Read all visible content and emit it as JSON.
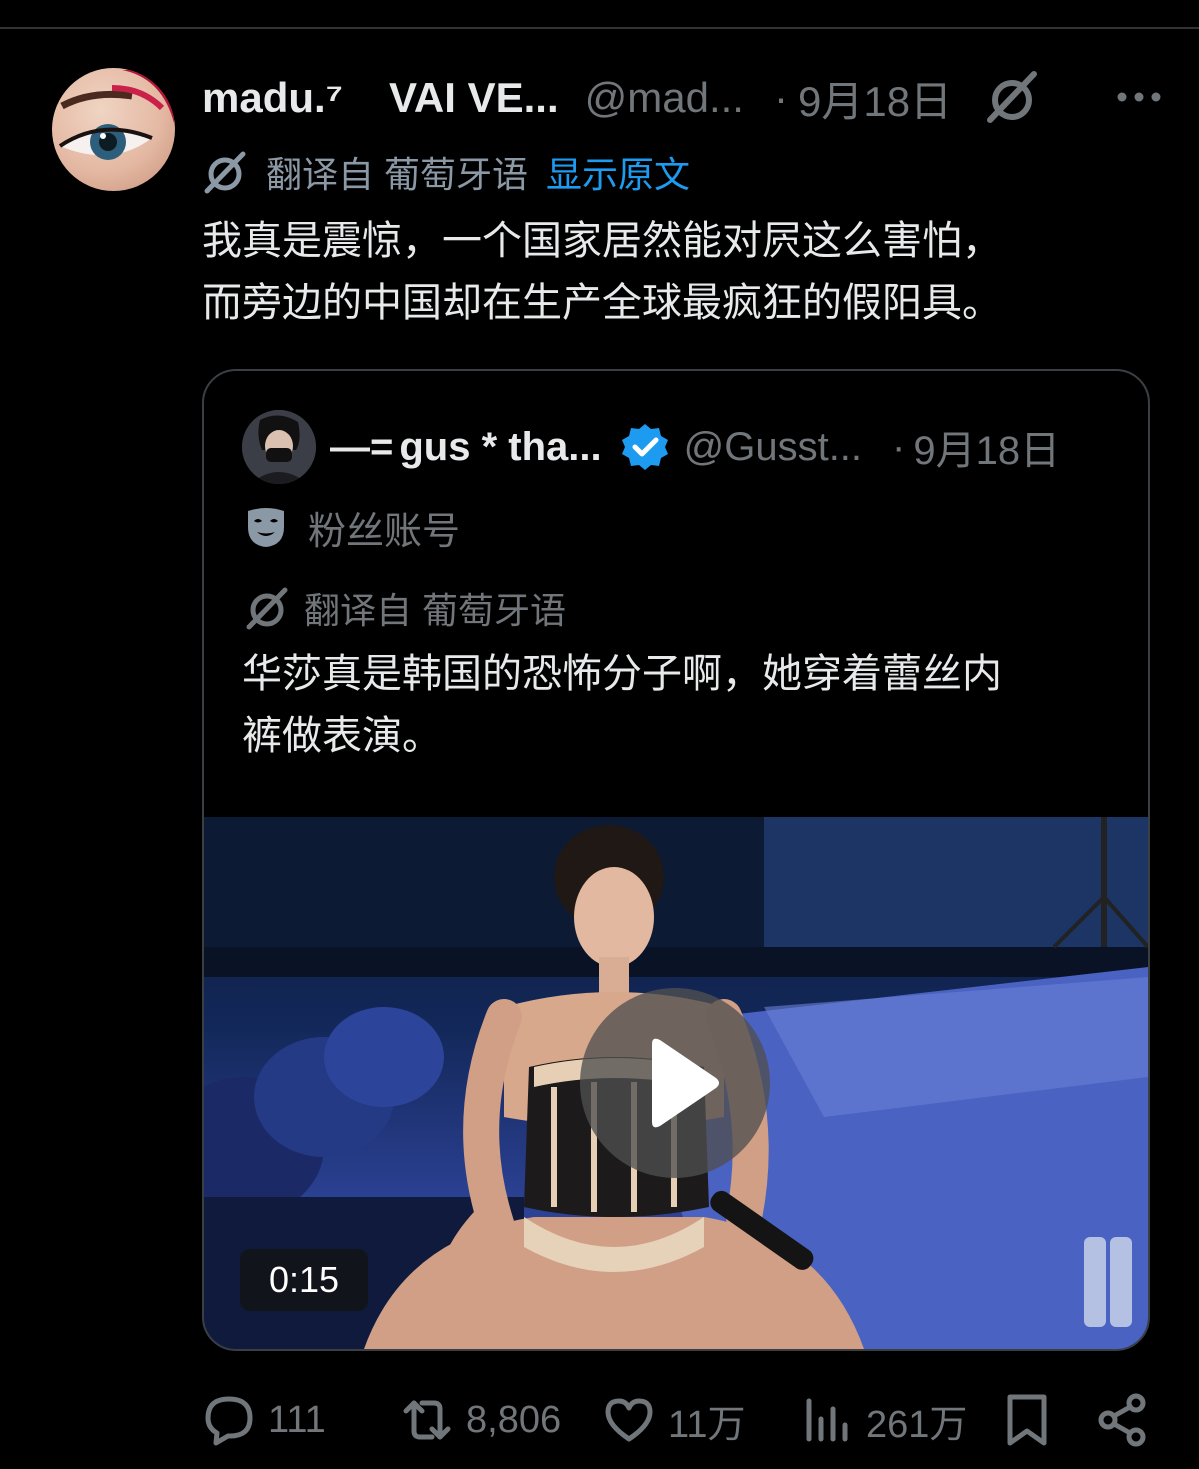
{
  "post": {
    "display_name": "madu.⁷",
    "display_name_suffix": "VAI VE...",
    "handle": "@mad...",
    "dot": "·",
    "date": "9月18日",
    "translated_from": "翻译自 葡萄牙语",
    "show_original": "显示原文",
    "text_line1": "我真是震惊，一个国家居然能对屄这么害怕，",
    "text_line2": "而旁边的中国却在生产全球最疯狂的假阳具。"
  },
  "quote": {
    "name_deco": "—=",
    "display_name": "gus * tha...",
    "handle": "@Gusst...",
    "dot": "·",
    "date": "9月18日",
    "fan_label": "粉丝账号",
    "translated_from": "翻译自 葡萄牙语",
    "text_line1": "华莎真是韩国的恐怖分子啊，她穿着蕾丝内",
    "text_line2": "裤做表演。",
    "video_duration": "0:15"
  },
  "actions": {
    "replies": "111",
    "reposts": "8,806",
    "likes": "11万",
    "views": "261万"
  },
  "icons": {
    "avatar": "avatar",
    "grok": "grok-icon",
    "more": "more-icon",
    "translate": "translate-icon",
    "verified": "verified-badge-icon",
    "fan_account": "mask-icon",
    "play": "play-icon",
    "reply": "reply-icon",
    "repost": "repost-icon",
    "like": "heart-icon",
    "views": "bar-chart-icon",
    "bookmark": "bookmark-icon",
    "share": "share-icon"
  },
  "colors": {
    "background": "#000000",
    "text": "#e7e9ea",
    "muted": "#71767b",
    "link": "#1d9bf0",
    "verified": "#1d9bf0"
  }
}
